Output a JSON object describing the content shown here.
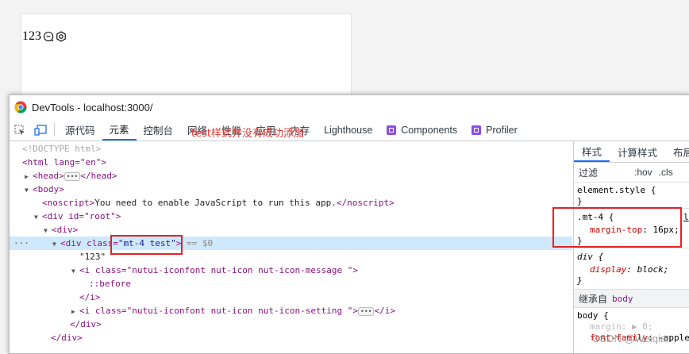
{
  "page": {
    "text": "123",
    "icons": [
      "message-icon",
      "setting-icon"
    ]
  },
  "titlebar": {
    "title": "DevTools - localhost:3000/"
  },
  "tabs": [
    {
      "label": "源代码"
    },
    {
      "label": "元素"
    },
    {
      "label": "控制台"
    },
    {
      "label": "网络"
    },
    {
      "label": "性能"
    },
    {
      "label": "应用"
    },
    {
      "label": "内存"
    },
    {
      "label": "Lighthouse"
    },
    {
      "label": "Components"
    },
    {
      "label": "Profiler"
    }
  ],
  "dom": {
    "doctype": "<!DOCTYPE html>",
    "html_open": "<html lang=\"en\">",
    "head": "<head>",
    "head_close": "</head>",
    "body": "<body>",
    "noscript_open": "<noscript>",
    "noscript_text": "You need to enable JavaScript to run this app.",
    "noscript_close": "</noscript>",
    "root_div": "<div id=\"root\">",
    "div_open": "<div>",
    "sel_div_pre": "<div class=",
    "sel_div_val": "\"mt-4 test\"",
    "sel_div_post": ">",
    "sel_marker": "== $0",
    "text_node": "\"123\"",
    "i_message": "<i class=\"nutui-iconfont nut-icon nut-icon-message \">",
    "before": "::before",
    "i_close": "</i>",
    "i_setting": "<i class=\"nutui-iconfont nut-icon nut-icon-setting \">",
    "i_setting_close": "</i>",
    "div_close": "</div>",
    "div_close2": "</div>"
  },
  "annotation": "test样式并没有成功添加",
  "styles": {
    "tabs": [
      "样式",
      "计算样式",
      "布局"
    ],
    "filter_label": "过滤",
    "hov": ":hov",
    "cls": ".cls",
    "element_style": "element.style {",
    "close_brace": "}",
    "mt4_selector": ".mt-4 {",
    "mt4_prop": "margin-top",
    "mt4_value": "16px;",
    "mt4_source": "l",
    "div_selector": "div {",
    "div_prop": "display",
    "div_value": "block;",
    "inherit_label": "继承自",
    "inherit_from": "body",
    "body_selector": "body {",
    "body_prop1": "margin",
    "body_val1": "▶ 0;",
    "body_prop2": "font-family",
    "body_val2": "-apple"
  },
  "watermark": "CSDN @Weiqian"
}
